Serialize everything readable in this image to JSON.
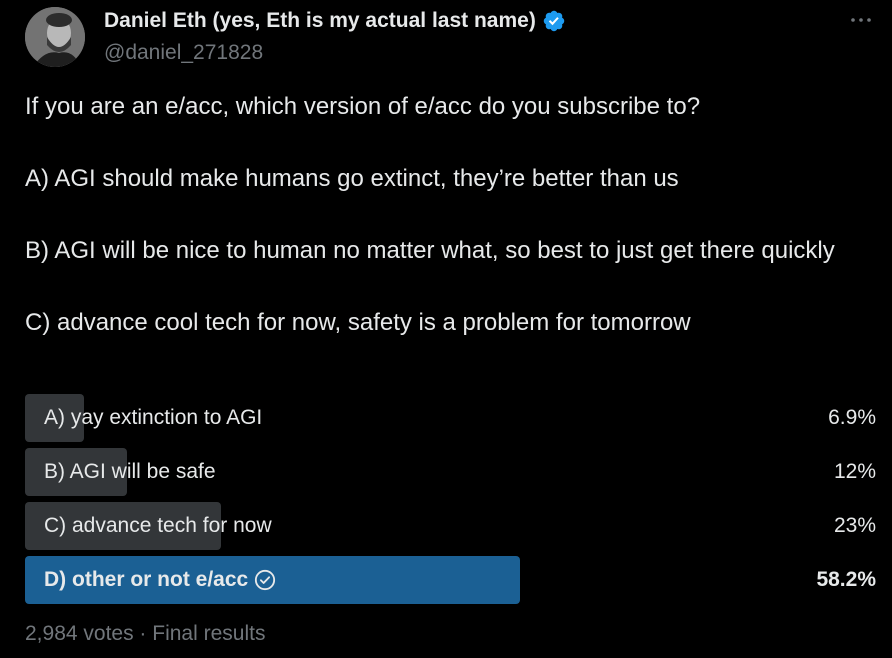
{
  "author": {
    "name": "Daniel Eth (yes, Eth is my actual last name)",
    "handle": "@daniel_271828",
    "verified": true
  },
  "tweet": {
    "lines": [
      "If you are an e/acc, which version of e/acc do you subscribe to?",
      "A) AGI should make humans go extinct, they’re better than us",
      "B) AGI will be nice to human no matter what, so best to just get there quickly",
      "C) advance cool tech for now, safety is a problem for tomorrow"
    ]
  },
  "poll": {
    "options": [
      {
        "label": "A) yay extinction to AGI",
        "percent_text": "6.9%",
        "percent": 6.9,
        "winner": false
      },
      {
        "label": "B) AGI will be safe",
        "percent_text": "12%",
        "percent": 12,
        "winner": false
      },
      {
        "label": "C) advance tech for now",
        "percent_text": "23%",
        "percent": 23,
        "winner": false
      },
      {
        "label": "D) other or not e/acc",
        "percent_text": "58.2%",
        "percent": 58.2,
        "winner": true
      }
    ],
    "footer": "2,984 votes · Final results"
  },
  "icons": {
    "verified": "verified-badge-icon",
    "more": "more-options-icon",
    "check": "check-circle-icon"
  },
  "colors": {
    "background": "#000000",
    "text": "#e7e9ea",
    "muted": "#71767b",
    "bar": "#333639",
    "winner_bar": "#1b6094",
    "verified": "#1d9bf0"
  }
}
